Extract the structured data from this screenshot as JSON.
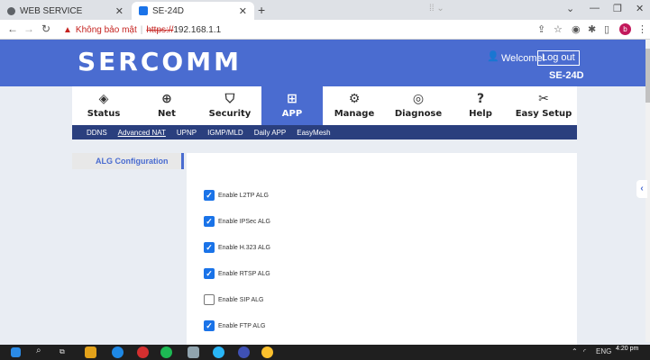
{
  "browser": {
    "tabs": [
      {
        "title": "WEB SERVICE",
        "icon": "globe-icon"
      },
      {
        "title": "SE-24D",
        "icon": "router-favicon"
      }
    ],
    "new_tab": "+",
    "security_warning": "Không bảo mật",
    "url_scheme": "https://",
    "url_host": "192.168.1.1",
    "profile_initial": "b"
  },
  "header": {
    "logo": "SERCOMM",
    "welcome": "Welcome!",
    "logout": "Log out",
    "model": "SE-24D"
  },
  "nav": {
    "items": [
      {
        "label": "Status",
        "icon": "status-icon"
      },
      {
        "label": "Net",
        "icon": "globe-icon"
      },
      {
        "label": "Security",
        "icon": "shield-icon"
      },
      {
        "label": "APP",
        "icon": "apps-grid-icon"
      },
      {
        "label": "Manage",
        "icon": "gear-icon"
      },
      {
        "label": "Diagnose",
        "icon": "diagnose-icon"
      },
      {
        "label": "Help",
        "icon": "help-icon"
      },
      {
        "label": "Easy Setup",
        "icon": "tools-icon"
      }
    ],
    "active": "APP"
  },
  "subnav": {
    "items": [
      "DDNS",
      "Advanced NAT",
      "UPNP",
      "IGMP/MLD",
      "Daily APP",
      "EasyMesh"
    ],
    "active": "Advanced NAT"
  },
  "sidebar": {
    "active_item": "ALG Configuration"
  },
  "alg_options": [
    {
      "label": "Enable L2TP ALG",
      "checked": true
    },
    {
      "label": "Enable IPSec ALG",
      "checked": true
    },
    {
      "label": "Enable H.323 ALG",
      "checked": true
    },
    {
      "label": "Enable RTSP ALG",
      "checked": true
    },
    {
      "label": "Enable SIP ALG",
      "checked": false
    },
    {
      "label": "Enable FTP ALG",
      "checked": true
    }
  ],
  "taskbar": {
    "language": "ENG",
    "time": "4:20 pm"
  },
  "colors": {
    "brand": "#4a6cd0",
    "subnav": "#2a3f7e",
    "checkbox": "#1a73e8",
    "warning": "#c5221f"
  }
}
